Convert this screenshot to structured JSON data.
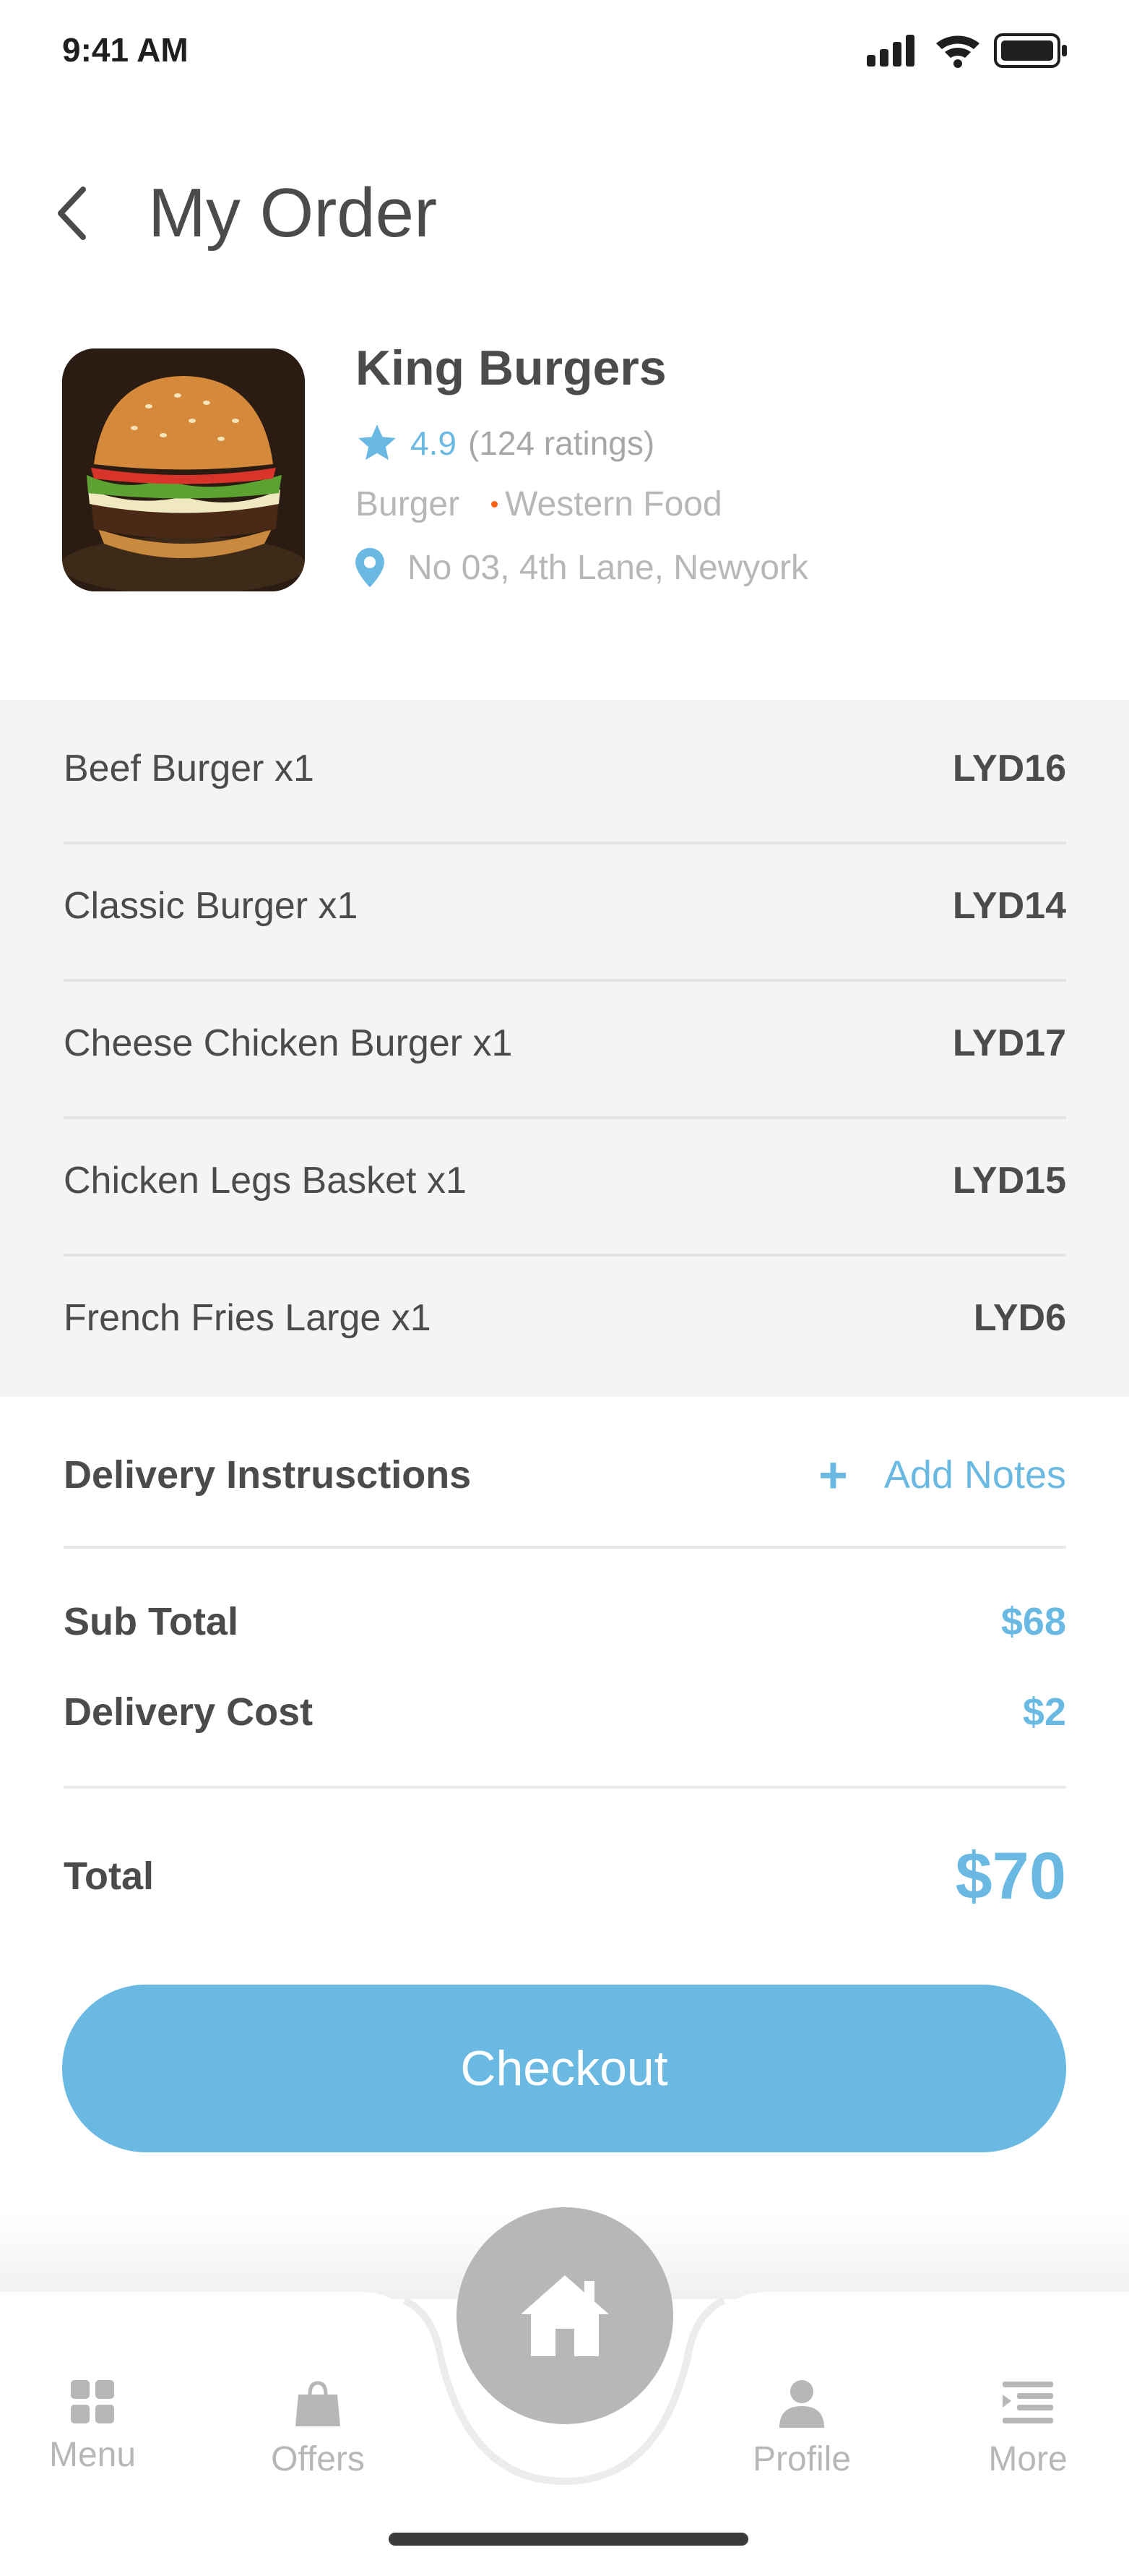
{
  "status_bar": {
    "time": "9:41 AM"
  },
  "header": {
    "title": "My Order"
  },
  "restaurant": {
    "name": "King Burgers",
    "rating": "4.9",
    "rating_count": "(124 ratings)",
    "category": "Burger",
    "cuisine": "Western Food",
    "address": "No 03, 4th Lane, Newyork"
  },
  "items": [
    {
      "name": "Beef Burger x1",
      "price": "LYD16"
    },
    {
      "name": "Classic Burger x1",
      "price": "LYD14"
    },
    {
      "name": "Cheese Chicken Burger x1",
      "price": "LYD17"
    },
    {
      "name": "Chicken Legs Basket x1",
      "price": "LYD15"
    },
    {
      "name": "French Fries Large x1",
      "price": "LYD6"
    }
  ],
  "instructions": {
    "label": "Delivery Instrusctions",
    "action": "Add Notes"
  },
  "summary": {
    "subtotal_label": "Sub Total",
    "subtotal": "$68",
    "delivery_label": "Delivery Cost",
    "delivery": "$2",
    "total_label": "Total",
    "total": "$70"
  },
  "checkout": {
    "label": "Checkout"
  },
  "tabs": {
    "menu": "Menu",
    "offers": "Offers",
    "profile": "Profile",
    "more": "More"
  },
  "colors": {
    "accent": "#6ab9e2",
    "text": "#4a4b4d",
    "muted": "#b6b7b7",
    "dot": "#fc6011"
  }
}
